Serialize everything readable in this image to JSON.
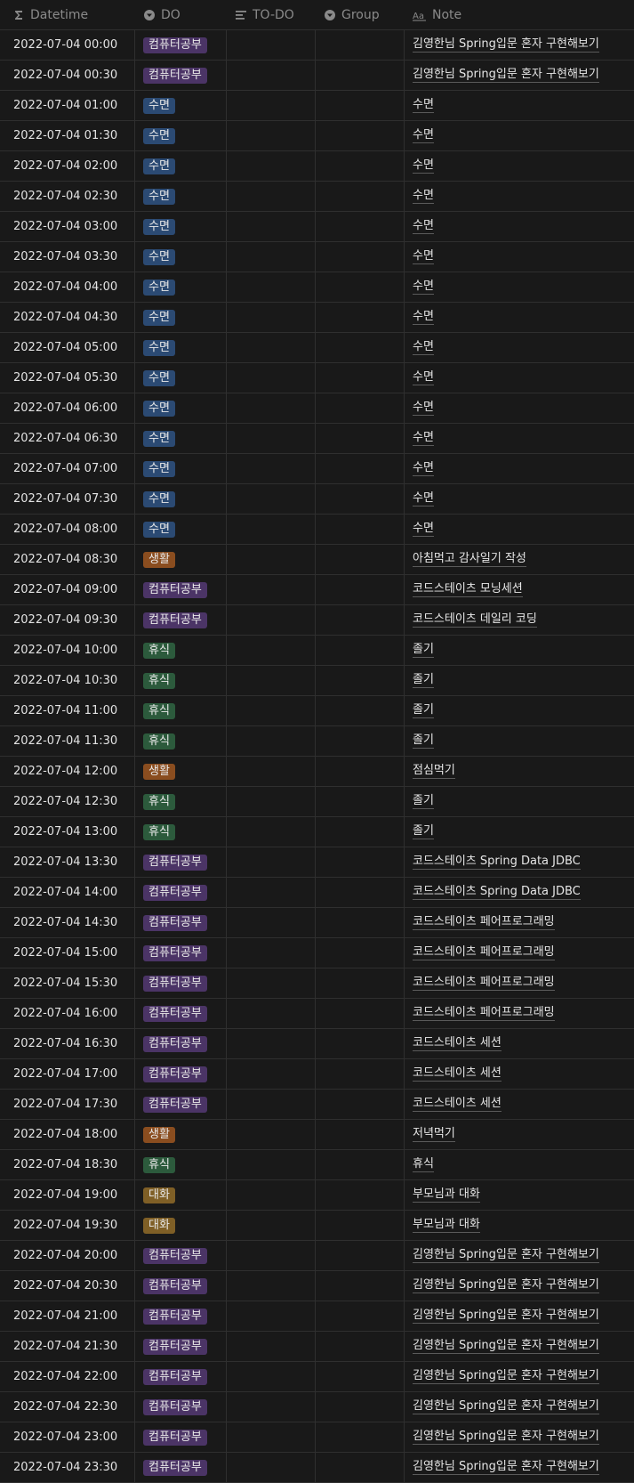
{
  "header": {
    "datetime": "Datetime",
    "do": "DO",
    "todo": "TO-DO",
    "group": "Group",
    "note": "Note"
  },
  "tag_colors": {
    "컴퓨터공부": "#4b3466",
    "수면": "#2b4a73",
    "생활": "#8a4d1f",
    "휴식": "#2c5a3c",
    "대화": "#7f5f26"
  },
  "rows": [
    {
      "datetime": "2022-07-04 00:00",
      "do": "컴퓨터공부",
      "todo": "",
      "group": "",
      "note": "김영한님 Spring입문 혼자 구현해보기"
    },
    {
      "datetime": "2022-07-04 00:30",
      "do": "컴퓨터공부",
      "todo": "",
      "group": "",
      "note": "김영한님 Spring입문 혼자 구현해보기"
    },
    {
      "datetime": "2022-07-04 01:00",
      "do": "수면",
      "todo": "",
      "group": "",
      "note": "수면"
    },
    {
      "datetime": "2022-07-04 01:30",
      "do": "수면",
      "todo": "",
      "group": "",
      "note": "수면"
    },
    {
      "datetime": "2022-07-04 02:00",
      "do": "수면",
      "todo": "",
      "group": "",
      "note": "수면"
    },
    {
      "datetime": "2022-07-04 02:30",
      "do": "수면",
      "todo": "",
      "group": "",
      "note": "수면"
    },
    {
      "datetime": "2022-07-04 03:00",
      "do": "수면",
      "todo": "",
      "group": "",
      "note": "수면"
    },
    {
      "datetime": "2022-07-04 03:30",
      "do": "수면",
      "todo": "",
      "group": "",
      "note": "수면"
    },
    {
      "datetime": "2022-07-04 04:00",
      "do": "수면",
      "todo": "",
      "group": "",
      "note": "수면"
    },
    {
      "datetime": "2022-07-04 04:30",
      "do": "수면",
      "todo": "",
      "group": "",
      "note": "수면"
    },
    {
      "datetime": "2022-07-04 05:00",
      "do": "수면",
      "todo": "",
      "group": "",
      "note": "수면"
    },
    {
      "datetime": "2022-07-04 05:30",
      "do": "수면",
      "todo": "",
      "group": "",
      "note": "수면"
    },
    {
      "datetime": "2022-07-04 06:00",
      "do": "수면",
      "todo": "",
      "group": "",
      "note": "수면"
    },
    {
      "datetime": "2022-07-04 06:30",
      "do": "수면",
      "todo": "",
      "group": "",
      "note": "수면"
    },
    {
      "datetime": "2022-07-04 07:00",
      "do": "수면",
      "todo": "",
      "group": "",
      "note": "수면"
    },
    {
      "datetime": "2022-07-04 07:30",
      "do": "수면",
      "todo": "",
      "group": "",
      "note": "수면"
    },
    {
      "datetime": "2022-07-04 08:00",
      "do": "수면",
      "todo": "",
      "group": "",
      "note": "수면"
    },
    {
      "datetime": "2022-07-04 08:30",
      "do": "생활",
      "todo": "",
      "group": "",
      "note": "아침먹고 감사일기 작성"
    },
    {
      "datetime": "2022-07-04 09:00",
      "do": "컴퓨터공부",
      "todo": "",
      "group": "",
      "note": "코드스테이츠 모닝세션"
    },
    {
      "datetime": "2022-07-04 09:30",
      "do": "컴퓨터공부",
      "todo": "",
      "group": "",
      "note": "코드스테이츠 데일리 코딩"
    },
    {
      "datetime": "2022-07-04 10:00",
      "do": "휴식",
      "todo": "",
      "group": "",
      "note": "졸기"
    },
    {
      "datetime": "2022-07-04 10:30",
      "do": "휴식",
      "todo": "",
      "group": "",
      "note": "졸기"
    },
    {
      "datetime": "2022-07-04 11:00",
      "do": "휴식",
      "todo": "",
      "group": "",
      "note": "졸기"
    },
    {
      "datetime": "2022-07-04 11:30",
      "do": "휴식",
      "todo": "",
      "group": "",
      "note": "졸기"
    },
    {
      "datetime": "2022-07-04 12:00",
      "do": "생활",
      "todo": "",
      "group": "",
      "note": "점심먹기"
    },
    {
      "datetime": "2022-07-04 12:30",
      "do": "휴식",
      "todo": "",
      "group": "",
      "note": "졸기"
    },
    {
      "datetime": "2022-07-04 13:00",
      "do": "휴식",
      "todo": "",
      "group": "",
      "note": "졸기"
    },
    {
      "datetime": "2022-07-04 13:30",
      "do": "컴퓨터공부",
      "todo": "",
      "group": "",
      "note": "코드스테이츠 Spring Data JDBC"
    },
    {
      "datetime": "2022-07-04 14:00",
      "do": "컴퓨터공부",
      "todo": "",
      "group": "",
      "note": "코드스테이츠 Spring Data JDBC"
    },
    {
      "datetime": "2022-07-04 14:30",
      "do": "컴퓨터공부",
      "todo": "",
      "group": "",
      "note": "코드스테이츠 페어프로그래밍"
    },
    {
      "datetime": "2022-07-04 15:00",
      "do": "컴퓨터공부",
      "todo": "",
      "group": "",
      "note": "코드스테이츠 페어프로그래밍"
    },
    {
      "datetime": "2022-07-04 15:30",
      "do": "컴퓨터공부",
      "todo": "",
      "group": "",
      "note": "코드스테이츠 페어프로그래밍"
    },
    {
      "datetime": "2022-07-04 16:00",
      "do": "컴퓨터공부",
      "todo": "",
      "group": "",
      "note": "코드스테이츠 페어프로그래밍"
    },
    {
      "datetime": "2022-07-04 16:30",
      "do": "컴퓨터공부",
      "todo": "",
      "group": "",
      "note": "코드스테이츠 세션"
    },
    {
      "datetime": "2022-07-04 17:00",
      "do": "컴퓨터공부",
      "todo": "",
      "group": "",
      "note": "코드스테이츠 세션"
    },
    {
      "datetime": "2022-07-04 17:30",
      "do": "컴퓨터공부",
      "todo": "",
      "group": "",
      "note": "코드스테이츠 세션"
    },
    {
      "datetime": "2022-07-04 18:00",
      "do": "생활",
      "todo": "",
      "group": "",
      "note": "저녁먹기"
    },
    {
      "datetime": "2022-07-04 18:30",
      "do": "휴식",
      "todo": "",
      "group": "",
      "note": "휴식"
    },
    {
      "datetime": "2022-07-04 19:00",
      "do": "대화",
      "todo": "",
      "group": "",
      "note": "부모님과 대화"
    },
    {
      "datetime": "2022-07-04 19:30",
      "do": "대화",
      "todo": "",
      "group": "",
      "note": "부모님과 대화"
    },
    {
      "datetime": "2022-07-04 20:00",
      "do": "컴퓨터공부",
      "todo": "",
      "group": "",
      "note": "김영한님 Spring입문 혼자 구현해보기"
    },
    {
      "datetime": "2022-07-04 20:30",
      "do": "컴퓨터공부",
      "todo": "",
      "group": "",
      "note": "김영한님 Spring입문 혼자 구현해보기"
    },
    {
      "datetime": "2022-07-04 21:00",
      "do": "컴퓨터공부",
      "todo": "",
      "group": "",
      "note": "김영한님 Spring입문 혼자 구현해보기"
    },
    {
      "datetime": "2022-07-04 21:30",
      "do": "컴퓨터공부",
      "todo": "",
      "group": "",
      "note": "김영한님 Spring입문 혼자 구현해보기"
    },
    {
      "datetime": "2022-07-04 22:00",
      "do": "컴퓨터공부",
      "todo": "",
      "group": "",
      "note": "김영한님 Spring입문 혼자 구현해보기"
    },
    {
      "datetime": "2022-07-04 22:30",
      "do": "컴퓨터공부",
      "todo": "",
      "group": "",
      "note": "김영한님 Spring입문 혼자 구현해보기"
    },
    {
      "datetime": "2022-07-04 23:00",
      "do": "컴퓨터공부",
      "todo": "",
      "group": "",
      "note": "김영한님 Spring입문 혼자 구현해보기"
    },
    {
      "datetime": "2022-07-04 23:30",
      "do": "컴퓨터공부",
      "todo": "",
      "group": "",
      "note": "김영한님 Spring입문 혼자 구현해보기"
    }
  ]
}
